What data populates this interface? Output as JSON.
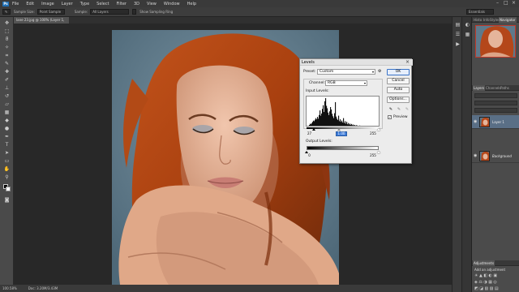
{
  "app": {
    "logo": "Ps",
    "menu": [
      "File",
      "Edit",
      "Image",
      "Layer",
      "Type",
      "Select",
      "Filter",
      "3D",
      "View",
      "Window",
      "Help"
    ]
  },
  "options_bar": {
    "sample_size_label": "Sample Size:",
    "sample_size_value": "Point Sample",
    "sample_label": "Sample:",
    "sample_value": "All Layers",
    "show_ring": "Show Sampling Ring",
    "workspace": "Essentials"
  },
  "document_tab": {
    "label": "lane 23.jpg @ 100% (Layer 1, RGB/8) *"
  },
  "status_bar": {
    "zoom": "100.58%",
    "doc": "Doc: 3.20M/3.43M"
  },
  "panels": {
    "navigator_tabs": [
      "Histo",
      "Info",
      "Styles",
      "Navigator"
    ],
    "layers_tabs": [
      "Layers",
      "Channels",
      "Paths"
    ],
    "layers": [
      {
        "name": "Layer 1"
      },
      {
        "name": "Background"
      }
    ],
    "adjustments_title": "Adjustments",
    "adjustments_hint": "Add an adjustment"
  },
  "levels_dialog": {
    "title": "Levels",
    "preset_label": "Preset:",
    "preset_value": "Custom",
    "channel_label": "Channel:",
    "channel_value": "RGB",
    "input_levels_label": "Input Levels:",
    "output_levels_label": "Output Levels:",
    "input_black": "27",
    "input_gray": "1.00",
    "input_white": "255",
    "output_black": "0",
    "output_white": "255",
    "buttons": {
      "ok": "OK",
      "cancel": "Cancel",
      "auto": "Auto",
      "options": "Options..."
    },
    "preview_label": "Preview",
    "preview_checked": true,
    "input_black_fraction": 0.106
  },
  "histogram_data": [
    2,
    3,
    5,
    8,
    12,
    10,
    14,
    18,
    22,
    20,
    25,
    30,
    26,
    34,
    28,
    40,
    55,
    38,
    45,
    60,
    72,
    50,
    85,
    95,
    70,
    62,
    48,
    40,
    52,
    66,
    58,
    44,
    36,
    30,
    46,
    82,
    35,
    28,
    24,
    38,
    20,
    26,
    18,
    22,
    16,
    30,
    14,
    20,
    12,
    18,
    10,
    14,
    9,
    12,
    8,
    11,
    7,
    9,
    6,
    8,
    5,
    7,
    6,
    5,
    4,
    6,
    4,
    5,
    3,
    4,
    3,
    4,
    3,
    3,
    2,
    3,
    2,
    2,
    2,
    2,
    1,
    2,
    1,
    1,
    1,
    1,
    1,
    1,
    1,
    2,
    3
  ]
}
